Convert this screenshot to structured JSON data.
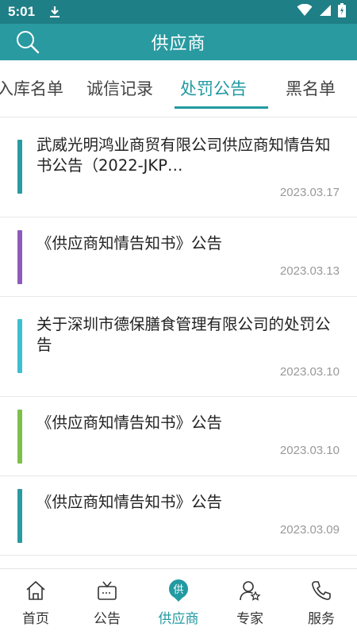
{
  "status_bar": {
    "time": "5:01"
  },
  "header": {
    "title": "供应商",
    "search_icon": "search-icon"
  },
  "tabs": [
    {
      "label": "入库名单",
      "active": false
    },
    {
      "label": "诚信记录",
      "active": false
    },
    {
      "label": "处罚公告",
      "active": true
    },
    {
      "label": "黑名单",
      "active": false
    }
  ],
  "items": [
    {
      "title": "武威光明鸿业商贸有限公司供应商知情告知书公告（2022-JKP…",
      "date": "2023.03.17",
      "color": "#2a9aa1"
    },
    {
      "title": "《供应商知情告知书》公告",
      "date": "2023.03.13",
      "color": "#8e5bbd"
    },
    {
      "title": "关于深圳市德保膳食管理有限公司的处罚公告",
      "date": "2023.03.10",
      "color": "#3dbfd0"
    },
    {
      "title": "《供应商知情告知书》公告",
      "date": "2023.03.10",
      "color": "#7cc04b"
    },
    {
      "title": "《供应商知情告知书》公告",
      "date": "2023.03.09",
      "color": "#2a9aa1"
    }
  ],
  "bottom_nav": [
    {
      "label": "首页",
      "icon": "home-icon",
      "active": false
    },
    {
      "label": "公告",
      "icon": "announcement-icon",
      "active": false
    },
    {
      "label": "供应商",
      "icon": "supplier-icon",
      "active": true,
      "icon_text": "供"
    },
    {
      "label": "专家",
      "icon": "expert-icon",
      "active": false
    },
    {
      "label": "服务",
      "icon": "phone-icon",
      "active": false
    }
  ],
  "colors": {
    "primary": "#2a9aa1",
    "status_bar": "#1f7f86"
  }
}
